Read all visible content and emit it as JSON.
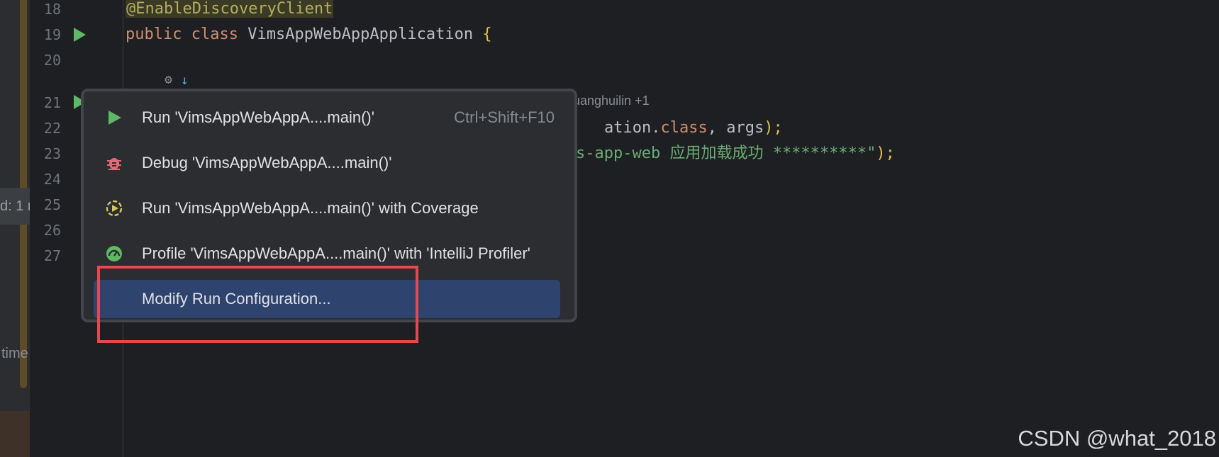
{
  "editor": {
    "line_numbers": [
      "18",
      "19",
      "20",
      "21",
      "22",
      "23",
      "24",
      "25",
      "26",
      "27"
    ],
    "line18": "@EnableDiscoveryClient",
    "line19_kw1": "public",
    "line19_kw2": "class",
    "line19_name": "VimsAppWebAppApplication",
    "line19_brace": "{",
    "author_hint": "uanghuilin +1",
    "line22_a": "ation.",
    "line22_kw": "class",
    "line22_b": ", args",
    "line22_c": ");",
    "line23_str": "s-app-web 应用加载成功 **********\"",
    "line23_end": ");"
  },
  "left_panel": {
    "tab_text": "d: 1 r",
    "time_text": "time"
  },
  "popup": {
    "items": [
      {
        "label": "Run 'VimsAppWebAppA....main()'",
        "shortcut": "Ctrl+Shift+F10",
        "icon": "run-icon"
      },
      {
        "label": "Debug 'VimsAppWebAppA....main()'",
        "shortcut": "",
        "icon": "debug-icon"
      },
      {
        "label": "Run 'VimsAppWebAppA....main()' with Coverage",
        "shortcut": "",
        "icon": "coverage-icon"
      },
      {
        "label": "Profile 'VimsAppWebAppA....main()' with 'IntelliJ Profiler'",
        "shortcut": "",
        "icon": "profiler-icon"
      },
      {
        "label": "Modify Run Configuration...",
        "shortcut": "",
        "icon": ""
      }
    ]
  },
  "colors": {
    "accent_green": "#5fb865",
    "selection": "#2e436e",
    "highlight_box": "#e5484d"
  },
  "watermark": "CSDN @what_2018"
}
